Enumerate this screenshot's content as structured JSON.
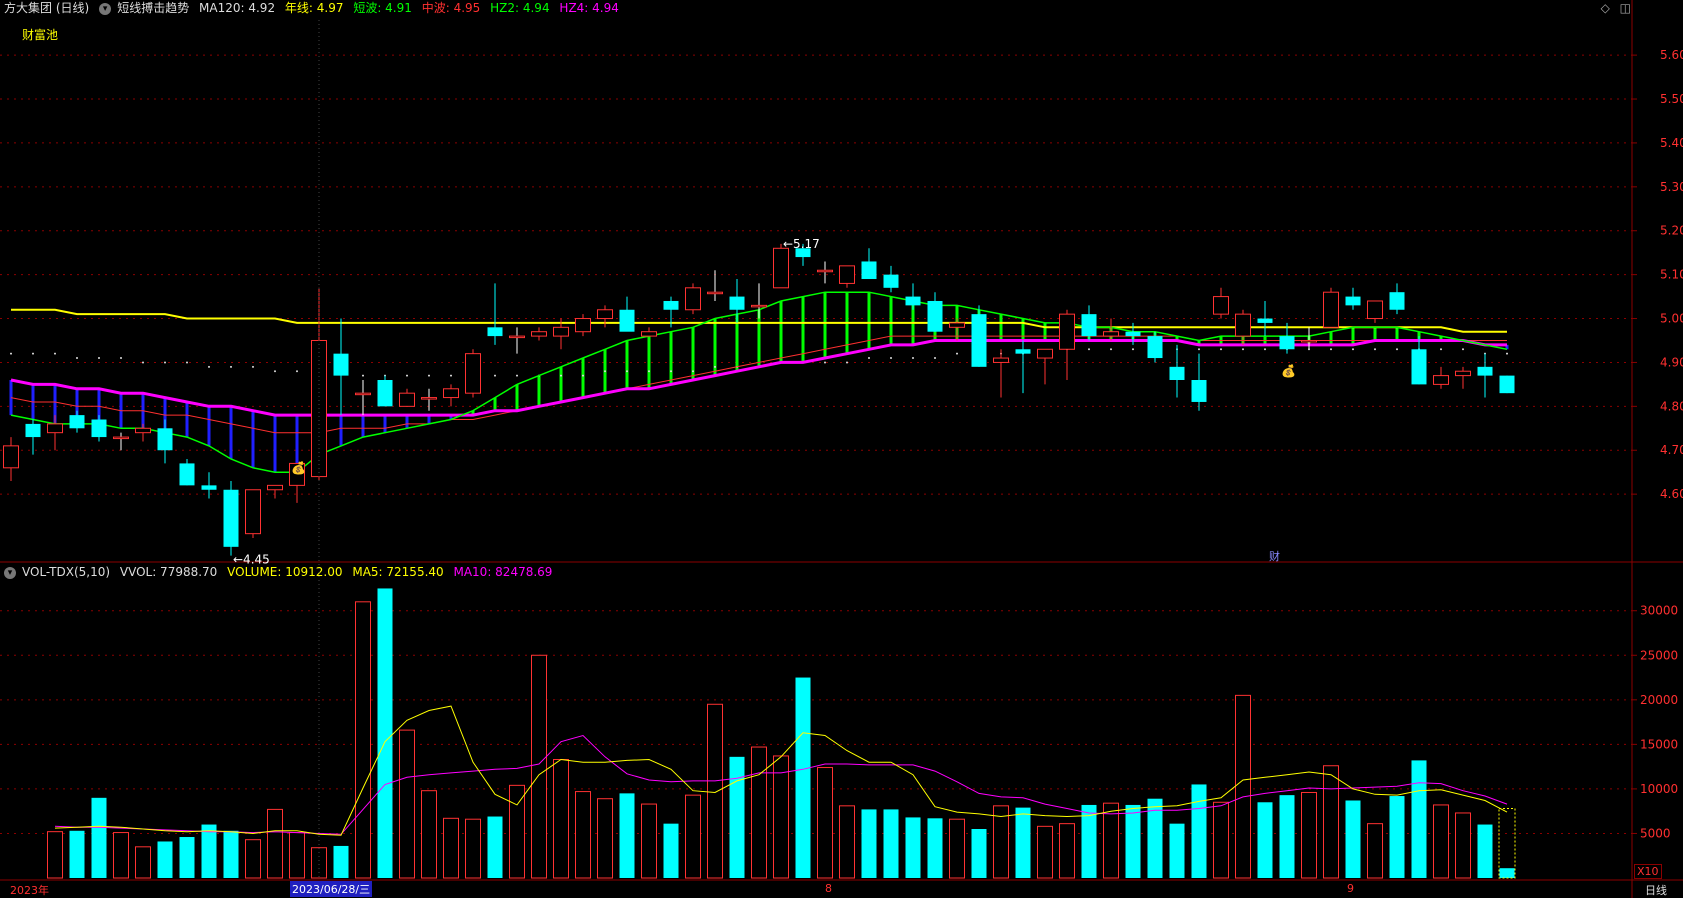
{
  "header": {
    "stock": "方大集团 (日线)",
    "indicator": "短线搏击趋势",
    "ma120": "MA120: 4.92",
    "year_line": "年线: 4.97",
    "short_wave": "短波: 4.91",
    "mid_wave": "中波: 4.95",
    "hz2": "HZ2: 4.94",
    "hz4": "HZ4: 4.94",
    "pool_label": "财富池"
  },
  "vol_header": {
    "name": "VOL-TDX(5,10)",
    "vvol": "VVOL: 77988.70",
    "volume": "VOLUME: 10912.00",
    "ma5": "MA5: 72155.40",
    "ma10": "MA10: 82478.69"
  },
  "bottom": {
    "year": "2023年",
    "cursor_date": "2023/06/28/三",
    "month_aug": "8",
    "month_sep": "9",
    "period": "日线",
    "vol_unit": "X10"
  },
  "markers": {
    "low": "4.45",
    "high": "5.17",
    "cai": "财"
  },
  "colors": {
    "up": "#ff3232",
    "down": "#00ffff",
    "year_line": "#ffff00",
    "short_wave": "#00ff00",
    "mid_wave": "#ff3030",
    "hz": "#ff00ff",
    "ma120": "#dddddd",
    "grid": "#8b0000",
    "volma5": "#ffff00",
    "volma10": "#ff00ff"
  },
  "chart_data": [
    {
      "type": "candlestick",
      "ylim": [
        4.45,
        5.68
      ],
      "y_ticks": [
        "5.60",
        "5.50",
        "5.40",
        "5.30",
        "5.20",
        "5.10",
        "5.00",
        "4.90",
        "4.80",
        "4.70",
        "4.60"
      ],
      "ohlc": [
        [
          4.66,
          4.73,
          4.63,
          4.71
        ],
        [
          4.76,
          4.77,
          4.69,
          4.73
        ],
        [
          4.74,
          4.78,
          4.7,
          4.76
        ],
        [
          4.78,
          4.79,
          4.74,
          4.75
        ],
        [
          4.77,
          4.78,
          4.72,
          4.73
        ],
        [
          4.73,
          4.74,
          4.7,
          4.73
        ],
        [
          4.74,
          4.76,
          4.72,
          4.75
        ],
        [
          4.75,
          4.77,
          4.67,
          4.7
        ],
        [
          4.67,
          4.68,
          4.62,
          4.62
        ],
        [
          4.62,
          4.65,
          4.59,
          4.61
        ],
        [
          4.61,
          4.63,
          4.46,
          4.48
        ],
        [
          4.51,
          4.61,
          4.5,
          4.61
        ],
        [
          4.61,
          4.62,
          4.59,
          4.62
        ],
        [
          4.62,
          4.67,
          4.58,
          4.67
        ],
        [
          4.64,
          5.07,
          4.63,
          4.95
        ],
        [
          4.92,
          5.0,
          4.78,
          4.87
        ],
        [
          4.83,
          4.86,
          4.78,
          4.83
        ],
        [
          4.86,
          4.87,
          4.8,
          4.8
        ],
        [
          4.8,
          4.84,
          4.8,
          4.83
        ],
        [
          4.82,
          4.84,
          4.79,
          4.82
        ],
        [
          4.82,
          4.85,
          4.8,
          4.84
        ],
        [
          4.83,
          4.93,
          4.82,
          4.92
        ],
        [
          4.98,
          5.08,
          4.94,
          4.96
        ],
        [
          4.96,
          4.98,
          4.92,
          4.96
        ],
        [
          4.96,
          4.98,
          4.95,
          4.97
        ],
        [
          4.96,
          5.0,
          4.93,
          4.98
        ],
        [
          4.97,
          5.01,
          4.96,
          5.0
        ],
        [
          5.0,
          5.03,
          4.98,
          5.02
        ],
        [
          5.02,
          5.05,
          4.98,
          4.97
        ],
        [
          4.96,
          4.98,
          4.96,
          4.97
        ],
        [
          5.04,
          5.05,
          4.98,
          5.02
        ],
        [
          5.02,
          5.08,
          5.01,
          5.07
        ],
        [
          5.06,
          5.11,
          5.04,
          5.06
        ],
        [
          5.05,
          5.09,
          4.99,
          5.02
        ],
        [
          5.03,
          5.08,
          5.0,
          5.03
        ],
        [
          5.07,
          5.17,
          5.07,
          5.16
        ],
        [
          5.16,
          5.17,
          5.12,
          5.14
        ],
        [
          5.11,
          5.13,
          5.08,
          5.11
        ],
        [
          5.08,
          5.12,
          5.07,
          5.12
        ],
        [
          5.13,
          5.16,
          5.09,
          5.09
        ],
        [
          5.1,
          5.12,
          5.06,
          5.07
        ],
        [
          5.05,
          5.08,
          5.02,
          5.03
        ],
        [
          5.04,
          5.06,
          4.97,
          4.97
        ],
        [
          4.98,
          5.0,
          4.95,
          4.99
        ],
        [
          5.01,
          5.03,
          4.89,
          4.89
        ],
        [
          4.9,
          4.93,
          4.82,
          4.91
        ],
        [
          4.93,
          4.95,
          4.83,
          4.92
        ],
        [
          4.91,
          4.93,
          4.85,
          4.93
        ],
        [
          4.93,
          5.02,
          4.86,
          5.01
        ],
        [
          5.01,
          5.03,
          4.95,
          4.96
        ],
        [
          4.96,
          5.0,
          4.95,
          4.97
        ],
        [
          4.97,
          4.99,
          4.94,
          4.96
        ],
        [
          4.96,
          4.97,
          4.9,
          4.91
        ],
        [
          4.89,
          4.94,
          4.82,
          4.86
        ],
        [
          4.86,
          4.92,
          4.79,
          4.81
        ],
        [
          5.01,
          5.07,
          5.0,
          5.05
        ],
        [
          4.96,
          5.02,
          4.94,
          5.01
        ],
        [
          5.0,
          5.04,
          4.96,
          4.99
        ],
        [
          4.96,
          4.99,
          4.92,
          4.93
        ],
        [
          4.95,
          4.98,
          4.93,
          4.95
        ],
        [
          4.98,
          5.07,
          4.98,
          5.06
        ],
        [
          5.05,
          5.07,
          5.02,
          5.03
        ],
        [
          5.0,
          5.04,
          4.99,
          5.04
        ],
        [
          5.06,
          5.08,
          5.01,
          5.02
        ],
        [
          4.93,
          4.96,
          4.85,
          4.85
        ],
        [
          4.85,
          4.89,
          4.84,
          4.87
        ],
        [
          4.87,
          4.89,
          4.84,
          4.88
        ],
        [
          4.89,
          4.92,
          4.82,
          4.87
        ],
        [
          4.87,
          4.87,
          4.83,
          4.83
        ]
      ],
      "series": [
        {
          "name": "MA120",
          "values": [
            4.92,
            4.92,
            4.92,
            4.91,
            4.91,
            4.91,
            4.9,
            4.9,
            4.9,
            4.89,
            4.89,
            4.89,
            4.88,
            4.88,
            4.88,
            4.88,
            4.87,
            4.87,
            4.87,
            4.87,
            4.87,
            4.87,
            4.87,
            4.87,
            4.87,
            4.87,
            4.87,
            4.88,
            4.88,
            4.88,
            4.88,
            4.88,
            4.89,
            4.89,
            4.89,
            4.9,
            4.9,
            4.9,
            4.9,
            4.91,
            4.91,
            4.91,
            4.91,
            4.92,
            4.92,
            4.92,
            4.92,
            4.92,
            4.93,
            4.93,
            4.93,
            4.93,
            4.93,
            4.93,
            4.93,
            4.93,
            4.93,
            4.93,
            4.93,
            4.93,
            4.93,
            4.93,
            4.93,
            4.93,
            4.93,
            4.93,
            4.93,
            4.92,
            4.92
          ]
        },
        {
          "name": "年线",
          "values": [
            5.02,
            5.02,
            5.02,
            5.01,
            5.01,
            5.01,
            5.01,
            5.01,
            5.0,
            5.0,
            5.0,
            5.0,
            5.0,
            4.99,
            4.99,
            4.99,
            4.99,
            4.99,
            4.99,
            4.99,
            4.99,
            4.99,
            4.99,
            4.99,
            4.99,
            4.99,
            4.99,
            4.99,
            4.99,
            4.99,
            4.99,
            4.99,
            4.99,
            4.99,
            4.99,
            4.99,
            4.99,
            4.99,
            4.99,
            4.99,
            4.99,
            4.99,
            4.99,
            4.99,
            4.99,
            4.99,
            4.99,
            4.98,
            4.98,
            4.98,
            4.98,
            4.98,
            4.98,
            4.98,
            4.98,
            4.98,
            4.98,
            4.98,
            4.98,
            4.98,
            4.98,
            4.98,
            4.98,
            4.98,
            4.98,
            4.98,
            4.97,
            4.97,
            4.97
          ]
        },
        {
          "name": "短波",
          "values": [
            4.78,
            4.77,
            4.76,
            4.76,
            4.76,
            4.75,
            4.75,
            4.74,
            4.73,
            4.71,
            4.68,
            4.66,
            4.65,
            4.65,
            4.69,
            4.71,
            4.73,
            4.74,
            4.75,
            4.76,
            4.77,
            4.79,
            4.82,
            4.85,
            4.87,
            4.89,
            4.91,
            4.93,
            4.95,
            4.96,
            4.97,
            4.98,
            5.0,
            5.01,
            5.02,
            5.04,
            5.05,
            5.06,
            5.06,
            5.06,
            5.05,
            5.04,
            5.03,
            5.03,
            5.02,
            5.01,
            5.0,
            4.99,
            4.99,
            4.98,
            4.98,
            4.97,
            4.97,
            4.96,
            4.95,
            4.96,
            4.96,
            4.96,
            4.96,
            4.96,
            4.97,
            4.98,
            4.98,
            4.98,
            4.97,
            4.96,
            4.95,
            4.94,
            4.93
          ]
        },
        {
          "name": "中波",
          "values": [
            4.82,
            4.81,
            4.81,
            4.8,
            4.8,
            4.79,
            4.79,
            4.78,
            4.78,
            4.77,
            4.76,
            4.75,
            4.74,
            4.74,
            4.74,
            4.75,
            4.75,
            4.75,
            4.76,
            4.76,
            4.77,
            4.77,
            4.78,
            4.79,
            4.8,
            4.81,
            4.82,
            4.83,
            4.84,
            4.85,
            4.86,
            4.87,
            4.88,
            4.89,
            4.9,
            4.91,
            4.92,
            4.93,
            4.94,
            4.95,
            4.96,
            4.96,
            4.96,
            4.96,
            4.96,
            4.96,
            4.96,
            4.96,
            4.96,
            4.96,
            4.96,
            4.96,
            4.96,
            4.96,
            4.95,
            4.95,
            4.95,
            4.95,
            4.95,
            4.95,
            4.95,
            4.95,
            4.95,
            4.95,
            4.95,
            4.95,
            4.95,
            4.95,
            4.95
          ]
        },
        {
          "name": "HZ",
          "values": [
            4.86,
            4.85,
            4.85,
            4.84,
            4.84,
            4.83,
            4.83,
            4.82,
            4.81,
            4.8,
            4.8,
            4.79,
            4.78,
            4.78,
            4.78,
            4.78,
            4.78,
            4.78,
            4.78,
            4.78,
            4.78,
            4.78,
            4.79,
            4.79,
            4.8,
            4.81,
            4.82,
            4.83,
            4.84,
            4.84,
            4.85,
            4.86,
            4.87,
            4.88,
            4.89,
            4.9,
            4.9,
            4.91,
            4.92,
            4.93,
            4.94,
            4.94,
            4.95,
            4.95,
            4.95,
            4.95,
            4.95,
            4.95,
            4.95,
            4.95,
            4.95,
            4.95,
            4.95,
            4.95,
            4.94,
            4.94,
            4.94,
            4.94,
            4.94,
            4.94,
            4.94,
            4.94,
            4.95,
            4.95,
            4.95,
            4.95,
            4.95,
            4.94,
            4.94
          ]
        }
      ]
    },
    {
      "type": "bar",
      "ylim": [
        0,
        33000
      ],
      "y_ticks": [
        "30000",
        "25000",
        "20000",
        "15000",
        "10000",
        "5000"
      ],
      "volume": [
        5200,
        5300,
        9000,
        5100,
        3500,
        4100,
        4600,
        6000,
        5300,
        4300,
        7700,
        5100,
        3400,
        3600,
        31000,
        32500,
        16600,
        9800,
        6700,
        6600,
        6900,
        10400,
        25000,
        13300,
        9700,
        8900,
        9500,
        8300,
        6100,
        9300,
        19500,
        13600,
        14700,
        13700,
        22500,
        12400,
        8100,
        7700,
        7700,
        6800,
        6700,
        6600,
        5500,
        8100,
        7900,
        5800,
        6100,
        8200,
        8400,
        8200,
        8900,
        6100,
        10500,
        8500,
        20500,
        8500,
        9300,
        9600,
        12600,
        8700,
        6100,
        9200,
        13200,
        8200,
        7300,
        6000,
        1100
      ],
      "series": [
        {
          "name": "MA5",
          "values": [
            5600,
            5700,
            5800,
            5700,
            5500,
            5300,
            5200,
            5300,
            5200,
            5000,
            5300,
            5300,
            4900,
            4800,
            10100,
            15300,
            17700,
            18800,
            19300,
            13000,
            9400,
            8200,
            11600,
            13300,
            13000,
            13000,
            13200,
            13300,
            12200,
            9800,
            9600,
            10900,
            11600,
            13600,
            16300,
            16000,
            14300,
            13000,
            13000,
            11600,
            8000,
            7400,
            7200,
            6900,
            7200,
            7000,
            6900,
            7000,
            7500,
            7800,
            8000,
            8100,
            8600,
            9000,
            11000,
            11300,
            11600,
            11900,
            11600,
            10000,
            9400,
            9300,
            9800,
            9900,
            9300,
            8700,
            7400
          ]
        },
        {
          "name": "MA10",
          "values": [
            5800,
            5700,
            5700,
            5600,
            5500,
            5400,
            5300,
            5200,
            5200,
            5100,
            5200,
            5100,
            5000,
            4900,
            7700,
            10500,
            11300,
            11600,
            11800,
            12000,
            12200,
            12300,
            12800,
            15300,
            16000,
            13600,
            11700,
            11000,
            10800,
            10900,
            10900,
            11200,
            11800,
            11800,
            12200,
            12800,
            12800,
            12700,
            12700,
            12700,
            12000,
            10800,
            9500,
            9100,
            9000,
            8300,
            7800,
            7300,
            7200,
            7300,
            7600,
            7600,
            7800,
            8100,
            9100,
            9500,
            9800,
            10100,
            10000,
            10100,
            10200,
            10300,
            10700,
            10600,
            9800,
            9200,
            8300
          ]
        }
      ]
    }
  ]
}
